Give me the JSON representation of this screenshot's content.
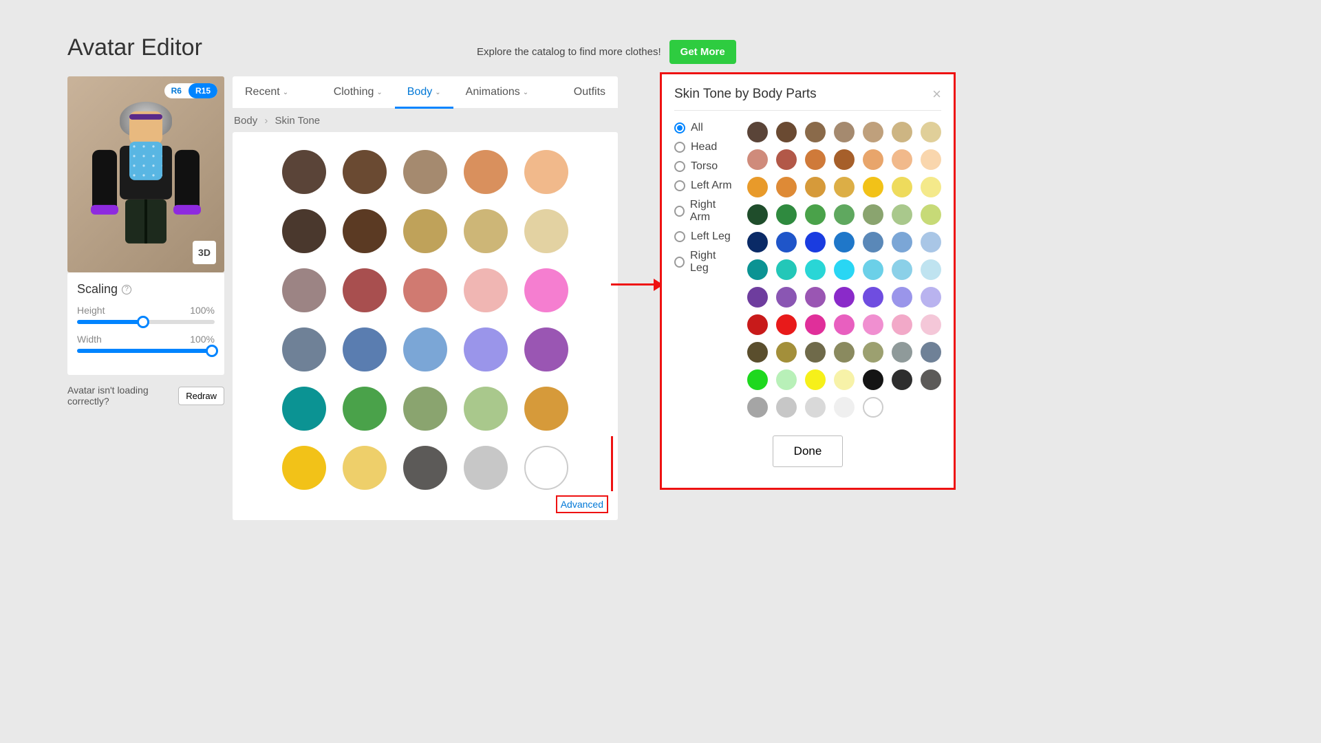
{
  "page_title": "Avatar Editor",
  "catalog_text": "Explore the catalog to find more clothes!",
  "get_more_label": "Get More",
  "rig": {
    "r6": "R6",
    "r15": "R15",
    "active": "R15"
  },
  "btn3d": "3D",
  "scaling": {
    "title": "Scaling",
    "height_label": "Height",
    "height_value": "100%",
    "height_pct": 48,
    "width_label": "Width",
    "width_value": "100%",
    "width_pct": 98
  },
  "redraw_text": "Avatar isn't loading correctly?",
  "redraw_btn": "Redraw",
  "tabs": [
    {
      "label": "Recent",
      "dropdown": true
    },
    {
      "label": "Clothing",
      "dropdown": true
    },
    {
      "label": "Body",
      "dropdown": true,
      "active": true
    },
    {
      "label": "Animations",
      "dropdown": true
    },
    {
      "label": "Outfits",
      "dropdown": false
    }
  ],
  "breadcrumb": {
    "root": "Body",
    "leaf": "Skin Tone"
  },
  "main_swatches": [
    "#5a4438",
    "#6a4a32",
    "#a58a6f",
    "#d9905d",
    "#f1b98b",
    "#4a382d",
    "#5b3a23",
    "#bfa25a",
    "#cdb677",
    "#e3d2a2",
    "#9c8484",
    "#a84f4f",
    "#d07a71",
    "#f0b6b3",
    "#f57ed0",
    "#6f8197",
    "#5a7db0",
    "#7ba6d6",
    "#9a95ea",
    "#9a56b3",
    "#0b9393",
    "#4aa24a",
    "#8aa46f",
    "#a9c88c",
    "#d69a3a",
    "#f2c218",
    "#eecf6a",
    "#5c5a58",
    "#c7c7c7",
    "hollow"
  ],
  "advanced_label": "Advanced",
  "modal": {
    "title": "Skin Tone by Body Parts",
    "parts": [
      "All",
      "Head",
      "Torso",
      "Left Arm",
      "Right Arm",
      "Left Leg",
      "Right Leg"
    ],
    "selected_part": "All",
    "done_label": "Done",
    "swatches": [
      "#5a4438",
      "#6a4a32",
      "#8a6a4a",
      "#a58a6f",
      "#bfa07c",
      "#cdb583",
      "#e0cf99",
      "#cf8b7b",
      "#b25848",
      "#cf7a3a",
      "#a65f2a",
      "#e8a56b",
      "#f1b98b",
      "#f9d6ad",
      "#e89a2a",
      "#de8a36",
      "#d69a3a",
      "#dcae46",
      "#f2c218",
      "#eedb5c",
      "#f4e98a",
      "#1f4d2b",
      "#2f8a3f",
      "#4aa24a",
      "#5fa85f",
      "#8aa46f",
      "#a9c88c",
      "#c7da77",
      "#0a2a66",
      "#1f55c9",
      "#1a3ce0",
      "#1f77c9",
      "#5a88b8",
      "#7ba6d6",
      "#a9c6e6",
      "#0b9393",
      "#23c7b8",
      "#29d6d6",
      "#29d6f4",
      "#6bd0e8",
      "#8bd0e8",
      "#bfe3f0",
      "#6e3d9e",
      "#8a56b3",
      "#9a56b3",
      "#8a2ac9",
      "#6f4de0",
      "#9a95ea",
      "#b9b3ef",
      "#c81a1a",
      "#e81a1a",
      "#e02f9a",
      "#e85fbf",
      "#f08fd0",
      "#f2a9c8",
      "#f4c7d8",
      "#5a4e2d",
      "#a38f3a",
      "#6f6a4a",
      "#8a8a5f",
      "#9ca070",
      "#8f9a9a",
      "#6f8197",
      "#1ed81e",
      "#b8f0b8",
      "#f6f01a",
      "#f7f2a8",
      "#141414",
      "#2e2e2e",
      "#5c5a58",
      "#a5a5a5",
      "#c7c7c7",
      "#d9d9d9",
      "#efefef",
      "hollow"
    ]
  }
}
